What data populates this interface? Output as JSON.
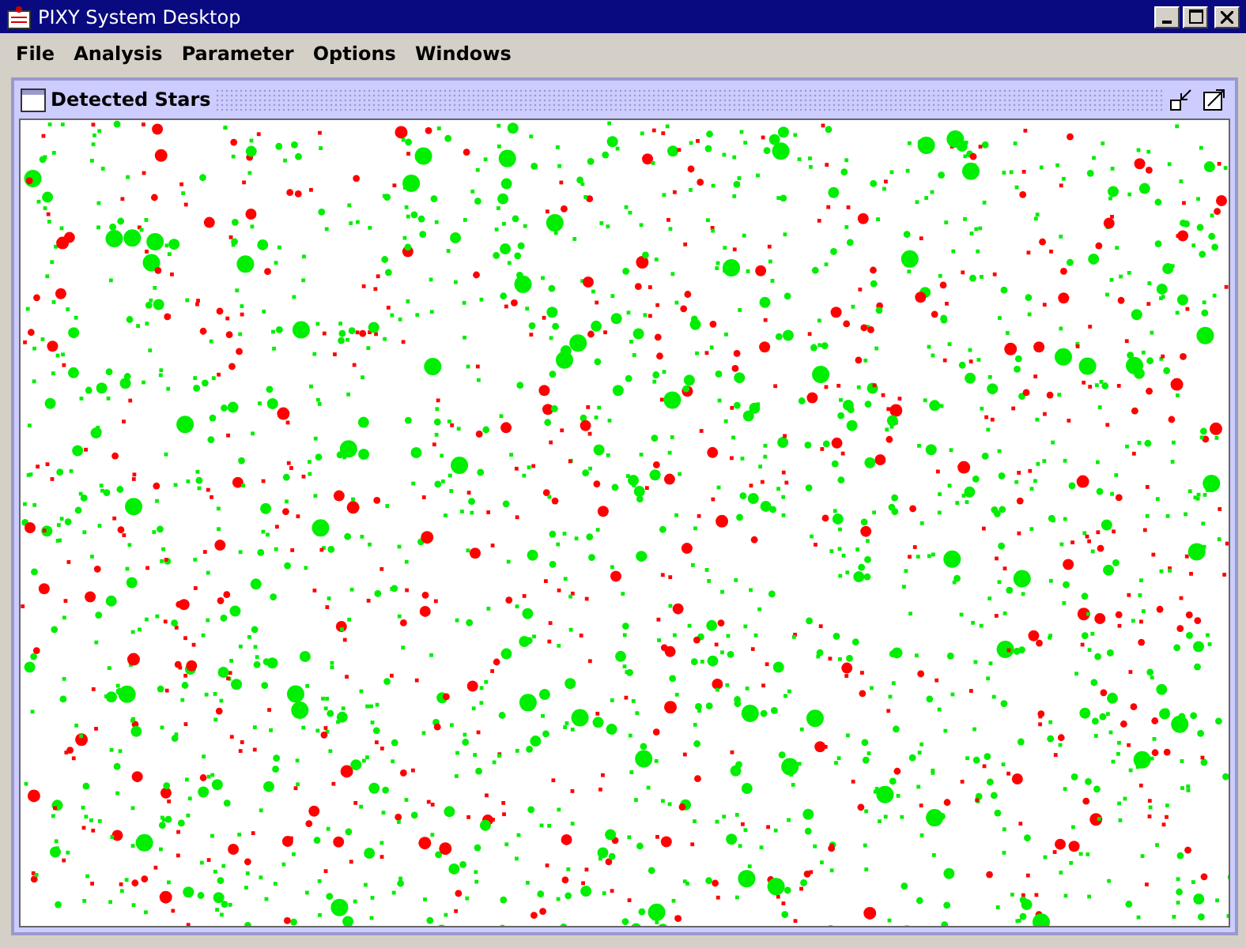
{
  "window": {
    "title": "PIXY System Desktop"
  },
  "menu": [
    "File",
    "Analysis",
    "Parameter",
    "Options",
    "Windows"
  ],
  "internal_frame": {
    "title": "Detected Stars"
  }
}
